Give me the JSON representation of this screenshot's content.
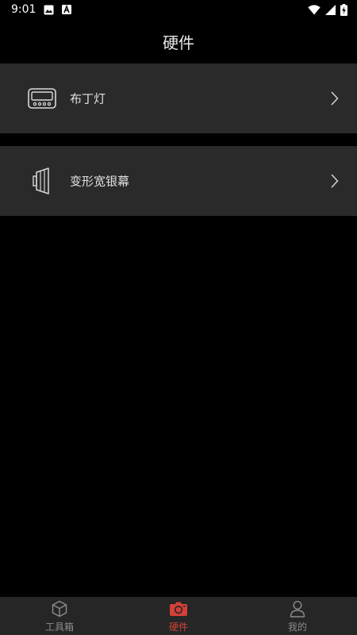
{
  "status_bar": {
    "time": "9:01",
    "icons": [
      "image-icon",
      "font-icon",
      "wifi-icon",
      "signal-icon",
      "battery-charging-icon"
    ]
  },
  "header": {
    "title": "硬件"
  },
  "hardware_list": {
    "items": [
      {
        "label": "布丁灯",
        "icon": "pudding-lamp-icon"
      },
      {
        "label": "变形宽银幕",
        "icon": "anamorphic-lens-icon"
      }
    ]
  },
  "bottom_nav": {
    "tabs": [
      {
        "label": "工具箱",
        "icon": "cube-icon",
        "active": false
      },
      {
        "label": "硬件",
        "icon": "camera-icon",
        "active": true
      },
      {
        "label": "我的",
        "icon": "person-icon",
        "active": false
      }
    ],
    "active_color": "#d2403a",
    "inactive_color": "#8c8c8c"
  }
}
